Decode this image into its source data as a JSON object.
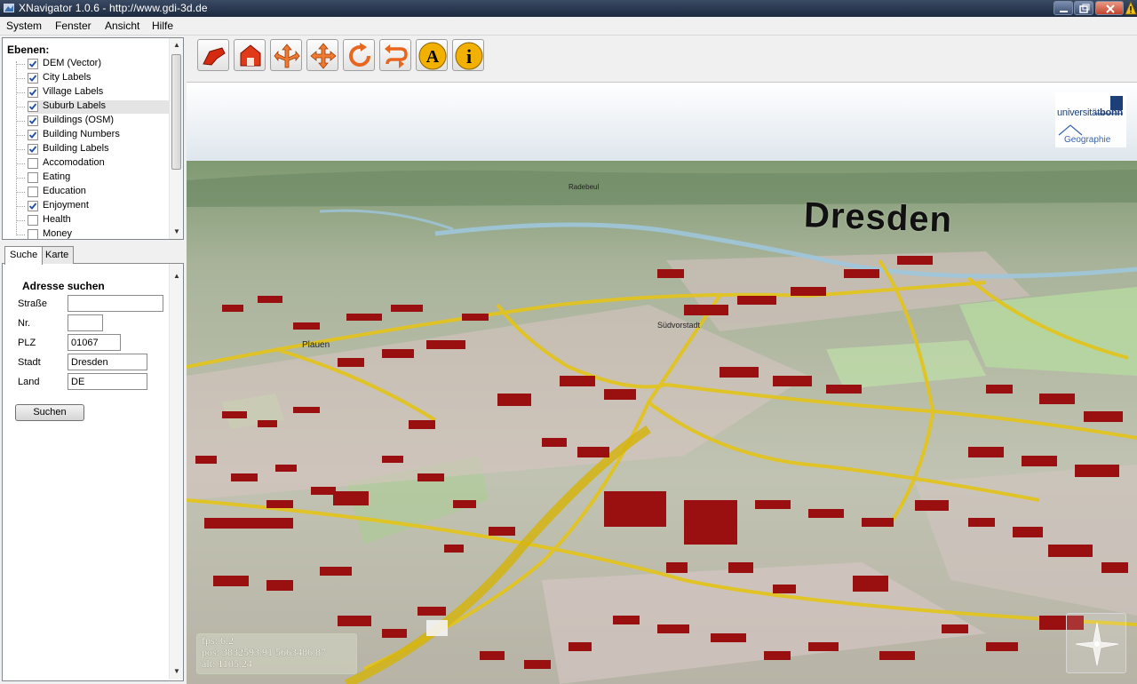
{
  "window": {
    "title": "XNavigator 1.0.6 - http://www.gdi-3d.de"
  },
  "menu": [
    "System",
    "Fenster",
    "Ansicht",
    "Hilfe"
  ],
  "layers": {
    "title": "Ebenen:",
    "items": [
      {
        "label": "DEM (Vector)",
        "checked": true
      },
      {
        "label": "City Labels",
        "checked": true
      },
      {
        "label": "Village Labels",
        "checked": true
      },
      {
        "label": "Suburb Labels",
        "checked": true,
        "selected": true
      },
      {
        "label": "Buildings (OSM)",
        "checked": true
      },
      {
        "label": "Building Numbers",
        "checked": true
      },
      {
        "label": "Building Labels",
        "checked": true
      },
      {
        "label": "Accomodation",
        "checked": false
      },
      {
        "label": "Eating",
        "checked": false
      },
      {
        "label": "Education",
        "checked": false
      },
      {
        "label": "Enjoyment",
        "checked": true
      },
      {
        "label": "Health",
        "checked": false
      },
      {
        "label": "Money",
        "checked": false
      }
    ]
  },
  "tabs": {
    "search": "Suche",
    "map": "Karte"
  },
  "search": {
    "heading": "Adresse suchen",
    "street_label": "Straße",
    "street_value": "",
    "number_label": "Nr.",
    "number_value": "",
    "zip_label": "PLZ",
    "zip_value": "01067",
    "city_label": "Stadt",
    "city_value": "Dresden",
    "country_label": "Land",
    "country_value": "DE",
    "button": "Suchen"
  },
  "toolbar": {
    "tools": [
      "fly-icon",
      "home-icon",
      "navigate-icon",
      "pan-icon",
      "rotate-icon",
      "path-icon",
      "annotation-icon",
      "info-icon"
    ],
    "annotation_glyph": "A",
    "info_glyph": "i"
  },
  "map": {
    "city_label": "Dresden",
    "suburb_labels": [
      "Plauen",
      "Südvorstadt",
      "Radebeul"
    ],
    "logo": {
      "university": "universität",
      "bonn": "bonn",
      "department": "Geographie"
    },
    "stats": {
      "fps": "fps: 6.2",
      "pos": "pos: 3832593.91  5663486.87",
      "alt": "alt: 1105.24"
    },
    "colors": {
      "buildings": "#9a1010",
      "roads": "#e0c020",
      "terrain": "#b4bda6"
    }
  }
}
